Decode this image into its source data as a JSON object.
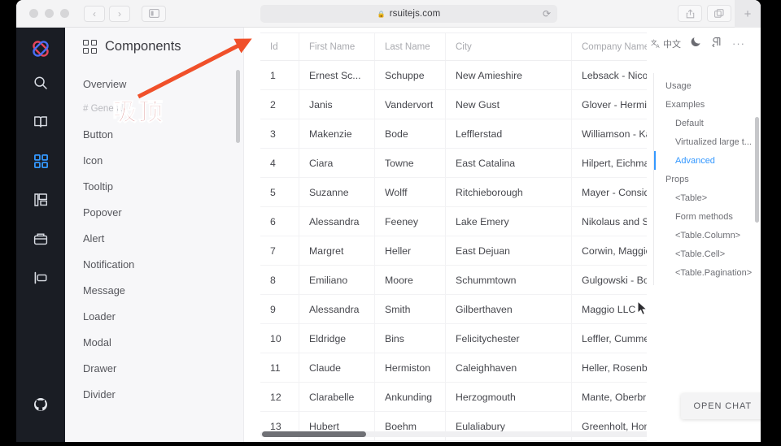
{
  "browser": {
    "url": "rsuitejs.com",
    "lock_icon": "lock-icon",
    "reload_icon": "reload-icon",
    "back_label": "‹",
    "forward_label": "›",
    "new_tab_label": "+"
  },
  "rail": {
    "items": [
      {
        "name": "logo",
        "icon": "rsuite-logo-icon"
      },
      {
        "name": "search",
        "icon": "search-icon"
      },
      {
        "name": "guide",
        "icon": "book-icon"
      },
      {
        "name": "components",
        "icon": "grid-icon",
        "active": true
      },
      {
        "name": "design",
        "icon": "palette-icon"
      },
      {
        "name": "resources",
        "icon": "box-icon"
      },
      {
        "name": "extensions",
        "icon": "panel-icon"
      }
    ],
    "github_icon": "github-icon"
  },
  "nav": {
    "title": "Components",
    "title_icon": "grid-icon",
    "items": [
      {
        "label": "Overview",
        "type": "item"
      },
      {
        "label": "# General",
        "type": "section"
      },
      {
        "label": "Button",
        "type": "item"
      },
      {
        "label": "Icon",
        "type": "item"
      },
      {
        "label": "Tooltip",
        "type": "item"
      },
      {
        "label": "Popover",
        "type": "item"
      },
      {
        "label": "Alert",
        "type": "item"
      },
      {
        "label": "Notification",
        "type": "item"
      },
      {
        "label": "Message",
        "type": "item"
      },
      {
        "label": "Loader",
        "type": "item"
      },
      {
        "label": "Modal",
        "type": "item"
      },
      {
        "label": "Drawer",
        "type": "item"
      },
      {
        "label": "Divider",
        "type": "item"
      }
    ]
  },
  "table": {
    "columns": [
      "Id",
      "First Name",
      "Last Name",
      "City",
      "Company Name"
    ],
    "rows": [
      [
        "1",
        "Ernest Sc...",
        "Schuppe",
        "New Amieshire",
        "Lebsack - Nicola"
      ],
      [
        "2",
        "Janis",
        "Vandervort",
        "New Gust",
        "Glover - Hermist"
      ],
      [
        "3",
        "Makenzie",
        "Bode",
        "Lefflerstad",
        "Williamson - Kas"
      ],
      [
        "4",
        "Ciara",
        "Towne",
        "East Catalina",
        "Hilpert, Eichman"
      ],
      [
        "5",
        "Suzanne",
        "Wolff",
        "Ritchieborough",
        "Mayer - Considi"
      ],
      [
        "6",
        "Alessandra",
        "Feeney",
        "Lake Emery",
        "Nikolaus and So"
      ],
      [
        "7",
        "Margret",
        "Heller",
        "East Dejuan",
        "Corwin, Maggio"
      ],
      [
        "8",
        "Emiliano",
        "Moore",
        "Schummtown",
        "Gulgowski - Bot"
      ],
      [
        "9",
        "Alessandra",
        "Smith",
        "Gilberthaven",
        "Maggio LLC"
      ],
      [
        "10",
        "Eldridge",
        "Bins",
        "Felicitychester",
        "Leffler, Cummer"
      ],
      [
        "11",
        "Claude",
        "Hermiston",
        "Caleighhaven",
        "Heller, Rosenba"
      ],
      [
        "12",
        "Clarabelle",
        "Ankunding",
        "Herzogmouth",
        "Mante, Oberbru"
      ],
      [
        "13",
        "Hubert",
        "Boehm",
        "Eulaliabury",
        "Greenholt, Hom"
      ]
    ]
  },
  "tools": {
    "lang_label": "中文",
    "lang_icon": "translate-icon",
    "theme_icon": "moon-icon",
    "direction_icon": "rtl-icon",
    "more_label": "···"
  },
  "toc": {
    "items": [
      {
        "label": "Usage",
        "level": 1,
        "active": false
      },
      {
        "label": "Examples",
        "level": 1,
        "active": false
      },
      {
        "label": "Default",
        "level": 2,
        "active": false
      },
      {
        "label": "Virtualized large t...",
        "level": 2,
        "active": false
      },
      {
        "label": "Advanced",
        "level": 2,
        "active": true
      },
      {
        "label": "Props",
        "level": 1,
        "active": false
      },
      {
        "label": "<Table>",
        "level": 2,
        "active": false
      },
      {
        "label": "Form methods",
        "level": 2,
        "active": false
      },
      {
        "label": "<Table.Column>",
        "level": 2,
        "active": false
      },
      {
        "label": "<Table.Cell>",
        "level": 2,
        "active": false
      },
      {
        "label": "<Table.Pagination>",
        "level": 2,
        "active": false
      }
    ]
  },
  "chat": {
    "label": "OPEN CHAT"
  },
  "annotation": {
    "text": "吸顶",
    "arrow_color": "#f0502a",
    "text_color": "#b01a1a"
  },
  "colors": {
    "accent": "#3498ff",
    "rail_bg": "#1a1d24",
    "nav_bg": "#f7f7f9"
  }
}
